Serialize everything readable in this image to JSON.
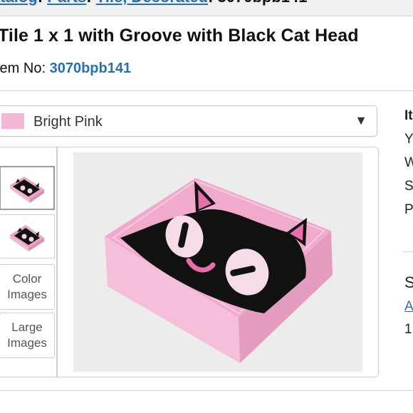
{
  "breadcrumb": {
    "items": [
      "atalog",
      "Parts",
      "Tile, Decorated",
      "3070bpb141"
    ]
  },
  "title": "Tile 1 x 1 with Groove with Black Cat Head",
  "item_no": {
    "label": "tem No:",
    "value": "3070bpb141"
  },
  "color_select": {
    "selected": "Bright Pink",
    "swatch_color": "#f5b6d6"
  },
  "thumbnails": {
    "color_images_label": "Color Images",
    "large_images_label": "Large Images"
  },
  "main_image": {
    "icon": "black-cat-tile-image"
  },
  "side_panel": {
    "lines": [
      "It",
      "Y",
      "W",
      "S",
      "P"
    ],
    "lower_lines": [
      "S",
      "A",
      "1"
    ]
  }
}
